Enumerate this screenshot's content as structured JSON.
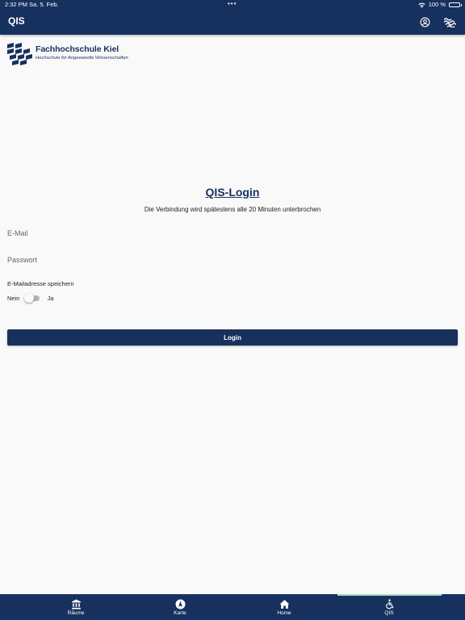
{
  "status_bar": {
    "time": "2:32 PM",
    "date": "Sa. 5. Feb.",
    "battery": "100 %"
  },
  "app_bar": {
    "title": "QIS",
    "account_icon": "account-circle-icon",
    "logo_icon": "fh-kiel-waves-icon"
  },
  "brand": {
    "name": "Fachhochschule Kiel",
    "subtitle": "Hochschule für Angewandte Wissenschaften"
  },
  "login": {
    "title": "QIS-Login",
    "info": "Die Verbindung wird spätestens alle 20 Minuten unterbrochen",
    "email_placeholder": "E-Mail",
    "email_value": "",
    "password_placeholder": "Passwort",
    "password_value": "",
    "remember_label": "E-Mailadresse speichern",
    "toggle_off_label": "Nein",
    "toggle_on_label": "Ja",
    "remember_enabled": false,
    "button_label": "Login"
  },
  "bottom_nav": {
    "items": [
      {
        "label": "Räume",
        "icon": "building-icon"
      },
      {
        "label": "Karte",
        "icon": "compass-icon"
      },
      {
        "label": "Home",
        "icon": "home-icon"
      },
      {
        "label": "QIS",
        "icon": "accessibility-icon"
      }
    ],
    "active": "QIS"
  },
  "colors": {
    "primary": "#17315e",
    "background": "#f9f9f9",
    "active_indicator": "#a8d9c6"
  }
}
